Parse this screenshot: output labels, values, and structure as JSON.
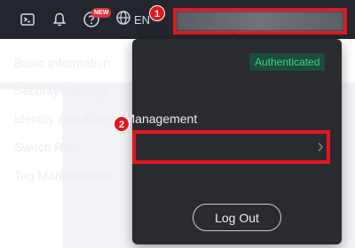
{
  "topbar": {
    "icons": [
      "terminal-icon",
      "bell-icon",
      "help-icon",
      "globe-icon"
    ],
    "new_badge": "NEW",
    "language": "EN"
  },
  "menu": {
    "items": [
      {
        "label": "Basic Information",
        "badge": "Authenticated"
      },
      {
        "label": "Security Settings"
      },
      {
        "label": "Identity and Access Management"
      },
      {
        "label": "Switch Role"
      },
      {
        "label": "Tag Management"
      }
    ],
    "logout_label": "Log Out"
  },
  "annotations": {
    "step1": "1",
    "step2": "2"
  },
  "colors": {
    "topbar_bg": "#23272d",
    "menu_bg": "#2a2b2e",
    "annotation_red": "#e5161e",
    "badge_green": "#3fd08f",
    "badge_bg": "#1b4d3a"
  }
}
